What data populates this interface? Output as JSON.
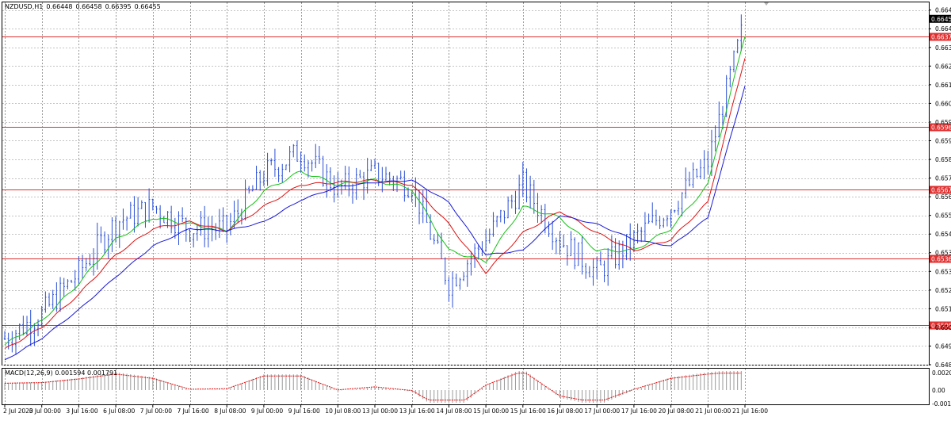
{
  "chart_header": {
    "symbol": "NZDUSD,H1",
    "open": "0.66448",
    "high": "0.66458",
    "low": "0.66395",
    "close": "0.66455"
  },
  "macd_header": {
    "name": "MACD(12,26,9)",
    "macd": "0.001594",
    "signal": "0.001791"
  },
  "colors": {
    "candle": "#2a4fd6",
    "ma_fast": "#16c216",
    "ma_mid": "#e01010",
    "ma_slow": "#1a1ad6",
    "level_line": "#e03030",
    "grid": "#9a9a9a",
    "current_price_bg": "#000000"
  },
  "price_axis": {
    "ticks": [
      "0.66495",
      "0.66410",
      "0.66325",
      "0.66240",
      "0.66155",
      "0.66070",
      "0.65985",
      "0.65900",
      "0.65815",
      "0.65730",
      "0.65645",
      "0.65560",
      "0.65475",
      "0.65390",
      "0.65305",
      "0.65220",
      "0.65135",
      "0.65050",
      "0.64965",
      "0.64880"
    ],
    "current_price": "0.66455",
    "levels": [
      "0.66373",
      "0.65963",
      "0.65677",
      "0.65364",
      "0.65061"
    ]
  },
  "macd_axis": {
    "ticks": [
      "0.002086",
      "0.00",
      "-0.001786"
    ]
  },
  "time_axis": {
    "labels": [
      "2 Jul 2020",
      "3 Jul 00:00",
      "3 Jul 16:00",
      "6 Jul 08:00",
      "7 Jul 00:00",
      "7 Jul 16:00",
      "8 Jul 08:00",
      "9 Jul 00:00",
      "9 Jul 16:00",
      "10 Jul 08:00",
      "13 Jul 00:00",
      "13 Jul 16:00",
      "14 Jul 08:00",
      "15 Jul 00:00",
      "15 Jul 16:00",
      "16 Jul 08:00",
      "17 Jul 00:00",
      "17 Jul 16:00",
      "20 Jul 08:00",
      "21 Jul 00:00",
      "21 Jul 16:00"
    ]
  },
  "chart_data": {
    "type": "line",
    "title": "NZDUSD,H1",
    "xlabel": "",
    "ylabel": "",
    "ylim": [
      0.6488,
      0.6653
    ],
    "x": [
      "2 Jul 2020",
      "3 Jul 00:00",
      "3 Jul 16:00",
      "6 Jul 08:00",
      "7 Jul 00:00",
      "7 Jul 16:00",
      "8 Jul 08:00",
      "9 Jul 00:00",
      "9 Jul 16:00",
      "10 Jul 08:00",
      "13 Jul 00:00",
      "13 Jul 16:00",
      "14 Jul 08:00",
      "15 Jul 00:00",
      "15 Jul 16:00",
      "16 Jul 08:00",
      "17 Jul 00:00",
      "17 Jul 16:00",
      "20 Jul 08:00",
      "21 Jul 00:00",
      "21 Jul 16:00"
    ],
    "series": [
      {
        "values": [
          0.65,
          0.6511,
          0.653,
          0.6553,
          0.656,
          0.655,
          0.655,
          0.6575,
          0.6585,
          0.6568,
          0.6575,
          0.657,
          0.6525,
          0.6545,
          0.657,
          0.6545,
          0.653,
          0.6545,
          0.656,
          0.658,
          0.6645
        ]
      },
      {
        "values": [
          0.6497,
          0.6508,
          0.6525,
          0.6545,
          0.6555,
          0.6552,
          0.6549,
          0.6567,
          0.6576,
          0.657,
          0.6572,
          0.6568,
          0.654,
          0.6535,
          0.656,
          0.6555,
          0.654,
          0.654,
          0.655,
          0.657,
          0.6638
        ]
      },
      {
        "values": [
          0.6495,
          0.6505,
          0.652,
          0.6538,
          0.655,
          0.6553,
          0.6549,
          0.656,
          0.657,
          0.6571,
          0.6572,
          0.657,
          0.6552,
          0.653,
          0.6548,
          0.6558,
          0.6548,
          0.654,
          0.6545,
          0.6562,
          0.6628
        ]
      },
      {
        "values": [
          0.649,
          0.65,
          0.6513,
          0.6528,
          0.6542,
          0.655,
          0.6549,
          0.6553,
          0.6563,
          0.6569,
          0.6571,
          0.6572,
          0.6562,
          0.6538,
          0.654,
          0.6556,
          0.6552,
          0.6545,
          0.6542,
          0.6555,
          0.6615
        ]
      }
    ]
  }
}
